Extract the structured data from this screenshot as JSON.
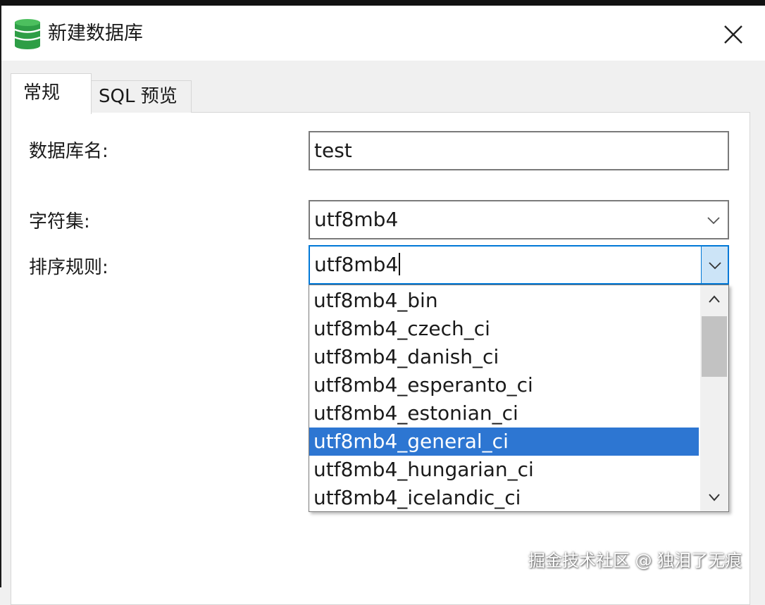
{
  "window": {
    "title": "新建数据库",
    "app_icon": "database-icon",
    "close_icon": "close-icon"
  },
  "tabs": [
    {
      "label": "常规",
      "active": true
    },
    {
      "label": "SQL 预览",
      "active": false
    }
  ],
  "form": {
    "db_name_label": "数据库名:",
    "db_name_value": "test",
    "charset_label": "字符集:",
    "charset_value": "utf8mb4",
    "collation_label": "排序规则:",
    "collation_value": "utf8mb4"
  },
  "collation_dropdown": {
    "options": [
      "utf8mb4_bin",
      "utf8mb4_czech_ci",
      "utf8mb4_danish_ci",
      "utf8mb4_esperanto_ci",
      "utf8mb4_estonian_ci",
      "utf8mb4_general_ci",
      "utf8mb4_hungarian_ci",
      "utf8mb4_icelandic_ci"
    ],
    "selected_option": "utf8mb4_general_ci"
  },
  "watermark": "掘金技术社区 @ 独泪了无痕",
  "colors": {
    "accent": "#0078d7",
    "selection": "#2d76d2",
    "icon_green": "#2e9e46"
  }
}
